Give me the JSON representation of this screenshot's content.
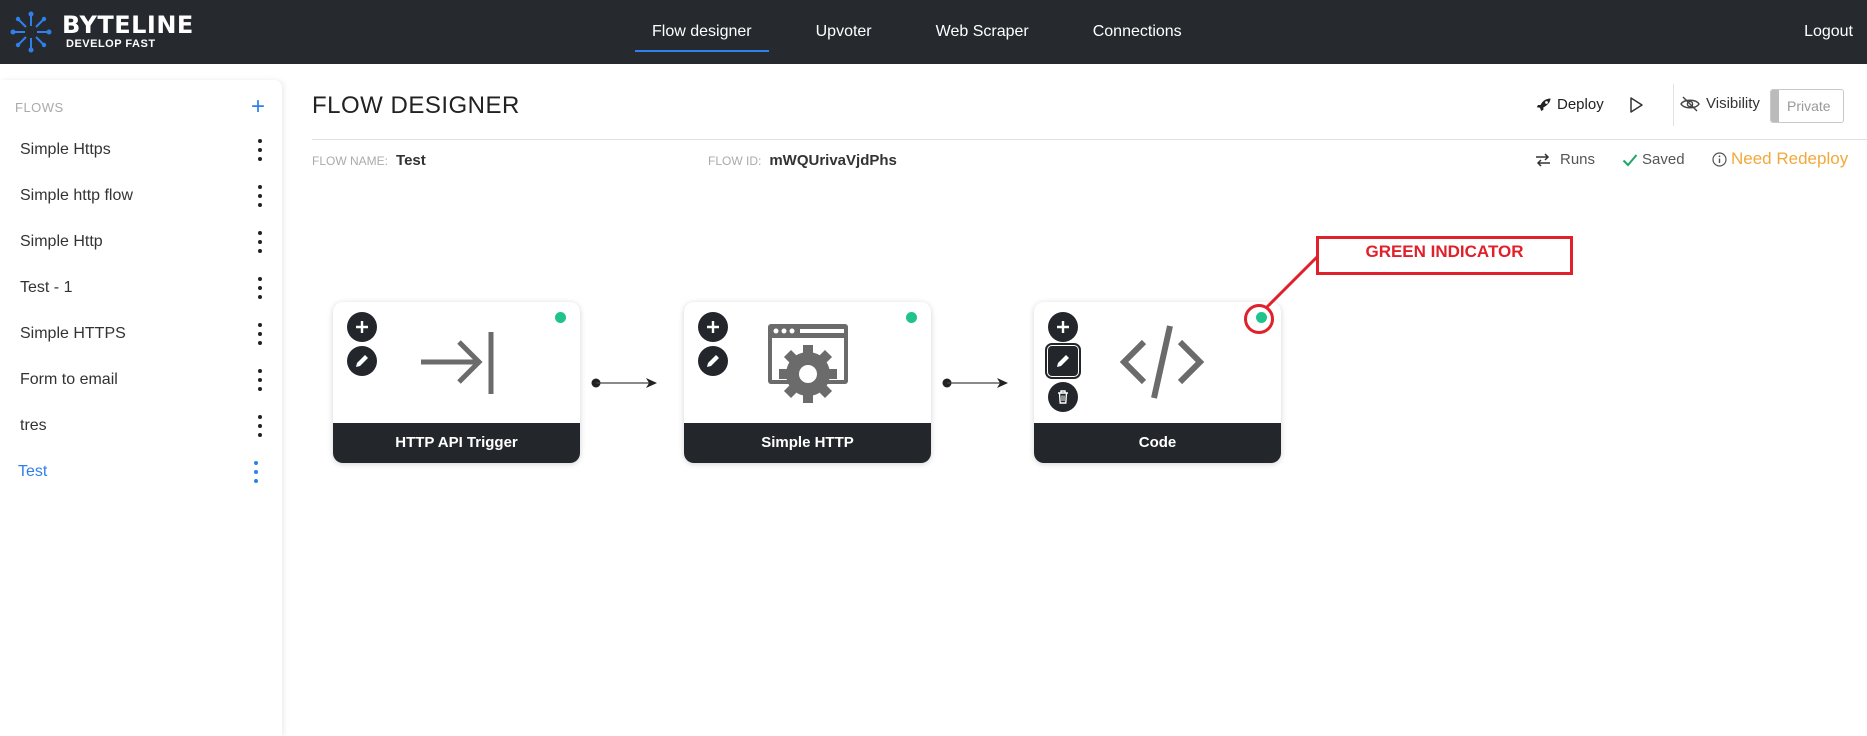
{
  "brand": {
    "name": "BYTELINE",
    "tagline": "DEVELOP FAST",
    "accent": "#2f80ed"
  },
  "nav": {
    "links": [
      {
        "label": "Flow designer",
        "active": true
      },
      {
        "label": "Upvoter"
      },
      {
        "label": "Web Scraper"
      },
      {
        "label": "Connections"
      }
    ],
    "logout": "Logout"
  },
  "sidebar": {
    "title": "FLOWS",
    "add_icon": "plus-icon",
    "items": [
      {
        "label": "Simple Https"
      },
      {
        "label": "Simple http flow"
      },
      {
        "label": "Simple Http"
      },
      {
        "label": "Test - 1"
      },
      {
        "label": "Simple HTTPS"
      },
      {
        "label": "Form to email"
      },
      {
        "label": "tres"
      },
      {
        "label": "Test",
        "active": true
      }
    ]
  },
  "header": {
    "title": "FLOW DESIGNER",
    "deploy_label": "Deploy",
    "visibility_label": "Visibility",
    "visibility_value": "Private"
  },
  "meta": {
    "flow_name_key": "FLOW NAME:",
    "flow_name": "Test",
    "flow_id_key": "FLOW ID:",
    "flow_id": "mWQUrivaVjdPhs",
    "runs_label": "Runs",
    "saved_label": "Saved",
    "redeploy_label": "Need Redeploy",
    "redeploy_color": "#f2a93b"
  },
  "nodes": [
    {
      "title": "HTTP API Trigger",
      "icon": "arrow-to-bar-icon",
      "status_color": "#1fc38b"
    },
    {
      "title": "Simple HTTP",
      "icon": "browser-gear-icon",
      "status_color": "#1fc38b"
    },
    {
      "title": "Code",
      "icon": "code-icon",
      "status_color": "#1fc38b"
    }
  ],
  "annotation": {
    "label": "GREEN INDICATOR",
    "color": "#e0202a"
  }
}
